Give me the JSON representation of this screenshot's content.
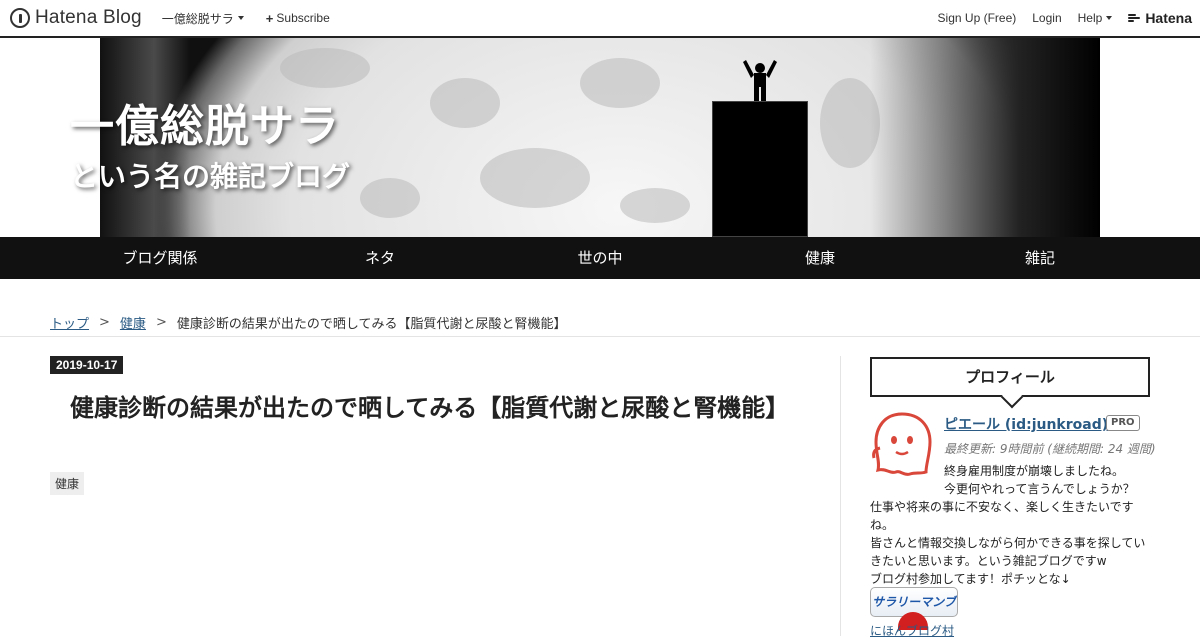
{
  "topbar": {
    "brand": "Hatena Blog",
    "blog_menu": "一億総脱サラ",
    "subscribe": "Subscribe",
    "signup": "Sign Up (Free)",
    "login": "Login",
    "help": "Help",
    "hatena": "Hatena"
  },
  "header": {
    "title": "一億総脱サラ",
    "description": "という名の雑記ブログ"
  },
  "categories": [
    "ブログ関係",
    "ネタ",
    "世の中",
    "健康",
    "雑記"
  ],
  "breadcrumb": {
    "top": "トップ",
    "category": "健康",
    "current": "健康診断の結果が出たので晒してみる【脂質代謝と尿酸と腎機能】",
    "separator": ">"
  },
  "entry": {
    "date": "2019-10-17",
    "title": "健康診断の結果が出たので晒してみる【脂質代謝と尿酸と腎機能】",
    "category_tag": "健康"
  },
  "sidebar": {
    "heading": "プロフィール",
    "name": "ピエール (id:junkroad)",
    "pro_badge": "PRO",
    "updated": "最終更新: 9時間前 (継続期間: 24 週間)",
    "intro_line1": "終身雇用制度が崩壊しましたね。",
    "intro_line2": "今更何やれって言うんでしょうか？",
    "intro_rest": "仕事や将来の事に不安なく、楽しく生きたいですね。\n皆さんと情報交換しながら何かできる事を探していきたいと思います。という雑記ブログですw\nブログ村参加してます！ポチッとな↓",
    "badge_label": "サラリーマンブログ",
    "link_partial": "にほんブログ村"
  },
  "colors": {
    "nav_bg": "#111111",
    "link": "#2b5b84",
    "date_bg": "#222222"
  }
}
